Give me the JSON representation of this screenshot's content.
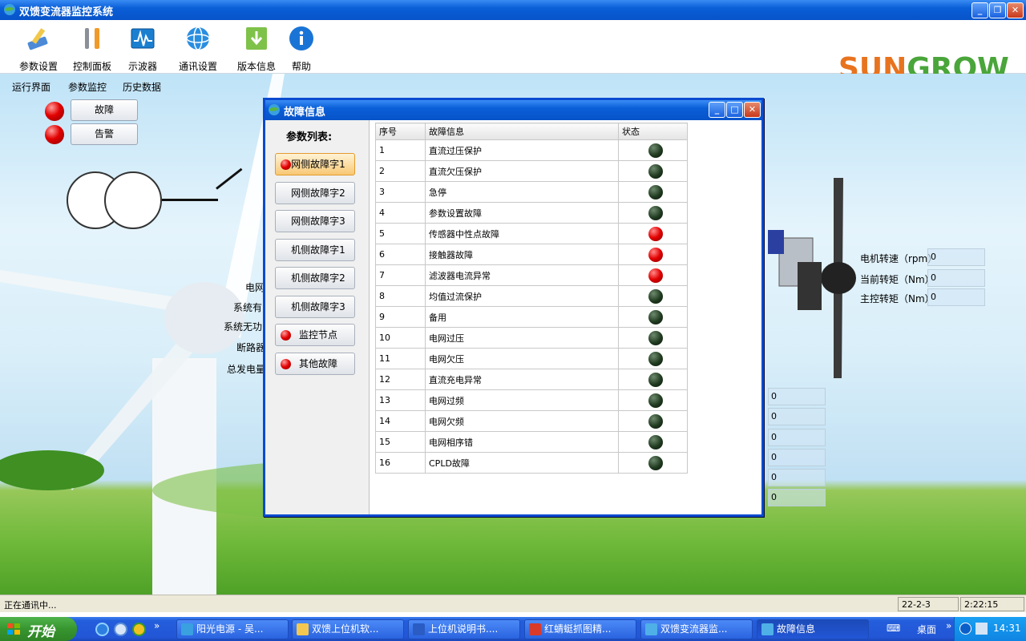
{
  "window": {
    "title": "双馈变流器监控系统"
  },
  "toolbar": {
    "items": [
      {
        "label": "参数设置",
        "icon": "wrench-pencil-icon"
      },
      {
        "label": "控制面板",
        "icon": "tools-icon"
      },
      {
        "label": "示波器",
        "icon": "oscilloscope-icon"
      },
      {
        "label": "通讯设置",
        "icon": "globe-icon"
      },
      {
        "label": "版本信息",
        "icon": "download-icon"
      },
      {
        "label": "帮助",
        "icon": "info-icon"
      }
    ],
    "logo": {
      "part1": "SUN",
      "part2": "GROW"
    }
  },
  "nav": {
    "items": [
      "运行界面",
      "参数监控",
      "历史数据"
    ]
  },
  "indicators": {
    "fault": "故障",
    "warning": "告警"
  },
  "background_labels": {
    "left": [
      "电网",
      "系统有",
      "系统无功",
      "断路器",
      "总发电量"
    ],
    "right": [
      {
        "label": "电机转速（rpm）",
        "value": "0"
      },
      {
        "label": "当前转矩（Nm）",
        "value": "0"
      },
      {
        "label": "主控转矩（Nm）",
        "value": "0"
      }
    ],
    "lower_values": [
      "0",
      "0",
      "0",
      "0",
      "0",
      "0"
    ]
  },
  "dialog": {
    "title": "故障信息",
    "list_header": "参数列表:",
    "list_items": [
      {
        "label": "网侧故障字1",
        "alarm": true,
        "active": true
      },
      {
        "label": "网侧故障字2",
        "alarm": false,
        "active": false
      },
      {
        "label": "网侧故障字3",
        "alarm": false,
        "active": false
      },
      {
        "label": "机侧故障字1",
        "alarm": false,
        "active": false
      },
      {
        "label": "机侧故障字2",
        "alarm": false,
        "active": false
      },
      {
        "label": "机侧故障字3",
        "alarm": false,
        "active": false
      },
      {
        "label": "监控节点",
        "alarm": true,
        "active": false
      },
      {
        "label": "其他故障",
        "alarm": true,
        "active": false
      }
    ],
    "table": {
      "headers": [
        "序号",
        "故障信息",
        "状态"
      ],
      "rows": [
        {
          "no": "1",
          "info": "直流过压保护",
          "status": "ok"
        },
        {
          "no": "2",
          "info": "直流欠压保护",
          "status": "ok"
        },
        {
          "no": "3",
          "info": "急停",
          "status": "ok"
        },
        {
          "no": "4",
          "info": "参数设置故障",
          "status": "ok"
        },
        {
          "no": "5",
          "info": "传感器中性点故障",
          "status": "fault"
        },
        {
          "no": "6",
          "info": "接触器故障",
          "status": "fault"
        },
        {
          "no": "7",
          "info": "滤波器电流异常",
          "status": "fault"
        },
        {
          "no": "8",
          "info": "均值过流保护",
          "status": "ok"
        },
        {
          "no": "9",
          "info": "备用",
          "status": "ok"
        },
        {
          "no": "10",
          "info": "电网过压",
          "status": "ok"
        },
        {
          "no": "11",
          "info": "电网欠压",
          "status": "ok"
        },
        {
          "no": "12",
          "info": "直流充电异常",
          "status": "ok"
        },
        {
          "no": "13",
          "info": "电网过频",
          "status": "ok"
        },
        {
          "no": "14",
          "info": "电网欠频",
          "status": "ok"
        },
        {
          "no": "15",
          "info": "电网相序错",
          "status": "ok"
        },
        {
          "no": "16",
          "info": "CPLD故障",
          "status": "ok"
        }
      ]
    }
  },
  "statusbar": {
    "text": "正在通讯中...",
    "date": "22-2-3",
    "time": "2:22:15"
  },
  "taskbar": {
    "start": "开始",
    "tasks": [
      {
        "label": "阳光电源 - 吴...",
        "icon": "globe-icon"
      },
      {
        "label": "双馈上位机软...",
        "icon": "folder-icon"
      },
      {
        "label": "上位机说明书....",
        "icon": "word-icon"
      },
      {
        "label": "红蜻蜓抓图精...",
        "icon": "capture-icon"
      },
      {
        "label": "双馈变流器监...",
        "icon": "app-icon"
      },
      {
        "label": "故障信息",
        "icon": "app-icon"
      }
    ],
    "desktop": "桌面",
    "clock": "14:31"
  },
  "colors": {
    "fault_red": "#e20000",
    "ok_dark_green": "#1f3a1f",
    "title_blue": "#0a5fd8"
  }
}
